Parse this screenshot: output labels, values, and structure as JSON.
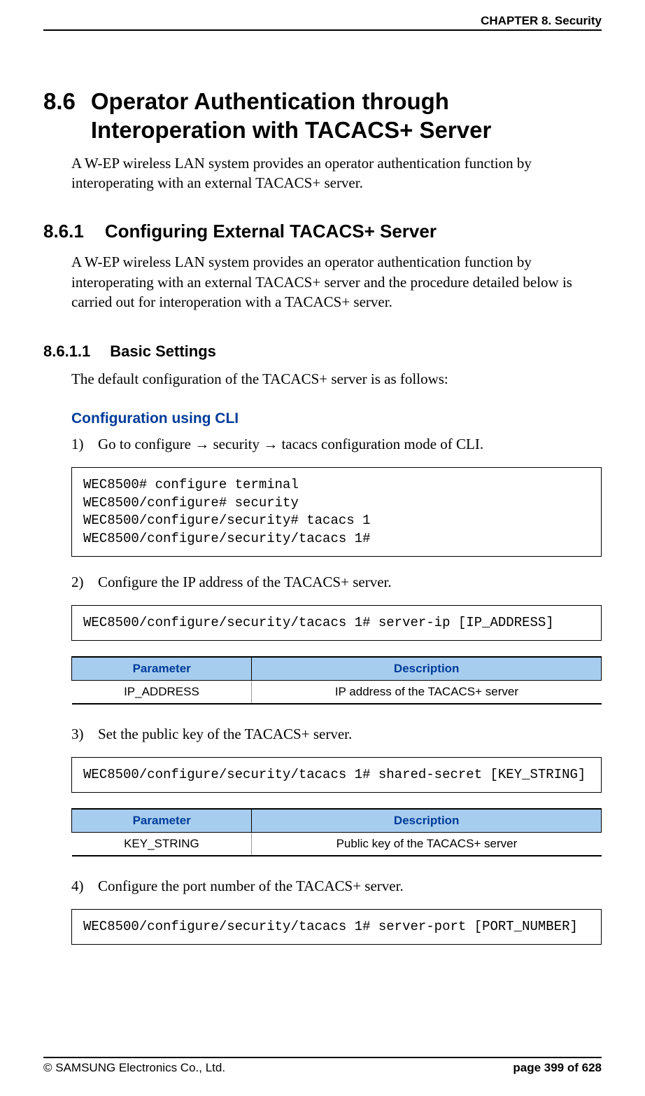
{
  "header": {
    "chapter_label": "CHAPTER 8. Security"
  },
  "footer": {
    "copyright": "© SAMSUNG Electronics Co., Ltd.",
    "page_label": "page 399 of 628"
  },
  "section": {
    "number": "8.6",
    "title": "Operator Authentication through Interoperation with TACACS+ Server",
    "intro": "A W-EP wireless LAN system provides an operator authentication function by interoperating with an external TACACS+ server."
  },
  "subsection": {
    "number": "8.6.1",
    "title": "Configuring External TACACS+ Server",
    "intro": "A W-EP wireless LAN system provides an operator authentication function by interoperating with an external TACACS+ server and the procedure detailed below is carried out for interoperation with a TACACS+ server."
  },
  "subsubsection": {
    "number": "8.6.1.1",
    "title": "Basic Settings",
    "intro": "The default configuration of the TACACS+ server is as follows:"
  },
  "cli_heading": "Configuration using CLI",
  "steps": {
    "s1": {
      "num": "1)",
      "text_pre": "Go to configure ",
      "text_mid1": " security ",
      "text_post": " tacacs configuration mode of CLI."
    },
    "s2": {
      "num": "2)",
      "text": "Configure the IP address of the TACACS+ server."
    },
    "s3": {
      "num": "3)",
      "text": "Set the public key of the TACACS+ server."
    },
    "s4": {
      "num": "4)",
      "text": "Configure the port number of the TACACS+ server."
    }
  },
  "code": {
    "c1": "WEC8500# configure terminal\nWEC8500/configure# security\nWEC8500/configure/security# tacacs 1\nWEC8500/configure/security/tacacs 1#",
    "c2": "WEC8500/configure/security/tacacs 1# server-ip [IP_ADDRESS]",
    "c3": "WEC8500/configure/security/tacacs 1# shared-secret [KEY_STRING]",
    "c4": "WEC8500/configure/security/tacacs 1# server-port [PORT_NUMBER]"
  },
  "table_labels": {
    "parameter": "Parameter",
    "description": "Description"
  },
  "tables": {
    "t1": {
      "param": "IP_ADDRESS",
      "desc": "IP address of the TACACS+ server"
    },
    "t2": {
      "param": "KEY_STRING",
      "desc": "Public key of the TACACS+ server"
    }
  },
  "arrow": "→"
}
